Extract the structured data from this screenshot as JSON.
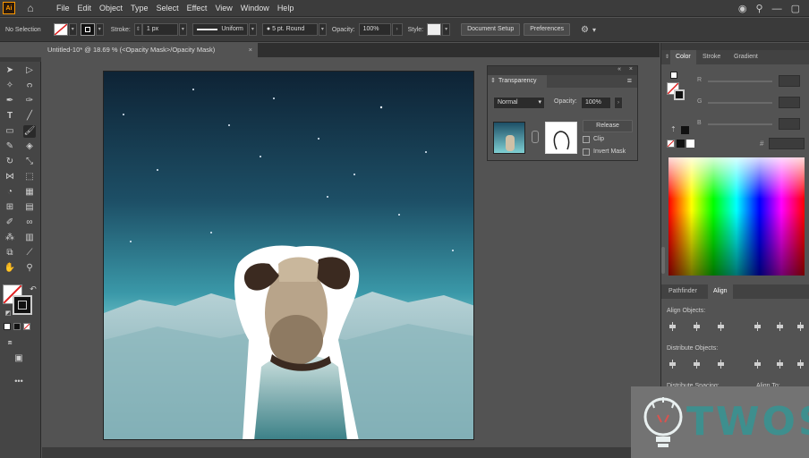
{
  "menubar": {
    "app_icon": "Ai",
    "items": [
      "File",
      "Edit",
      "Object",
      "Type",
      "Select",
      "Effect",
      "View",
      "Window",
      "Help"
    ]
  },
  "controlbar": {
    "selection_label": "No Selection",
    "stroke_label": "Stroke:",
    "stroke_weight": "1 px",
    "profile": "Uniform",
    "brush": "5 pt. Round",
    "opacity_label": "Opacity:",
    "opacity": "100%",
    "style_label": "Style:",
    "document_setup": "Document Setup",
    "preferences": "Preferences"
  },
  "document": {
    "tab_title": "Untitled-10* @ 18.69 % (<Opacity Mask>/Opacity Mask)",
    "close": "×"
  },
  "transparency": {
    "title": "Transparency",
    "blend_mode": "Normal",
    "opacity_label": "Opacity:",
    "opacity": "100%",
    "release": "Release",
    "clip": "Clip",
    "invert_mask": "Invert Mask",
    "collapse": "«",
    "close": "×"
  },
  "dock": {
    "color_tabs": [
      "Color",
      "Stroke",
      "Gradient"
    ],
    "rgb_labels": [
      "R",
      "G",
      "B"
    ],
    "lower_tabs": [
      "Pathfinder",
      "Align"
    ],
    "align_objects": "Align Objects:",
    "distribute_objects": "Distribute Objects:",
    "distribute_spacing": "Distribute Spacing:",
    "align_to": "Align To:"
  },
  "watermark": {
    "text": "TWOS"
  },
  "colors": {
    "accent": "#ff9a00",
    "panel": "#535353",
    "watermark_teal": "#3e8f8e"
  }
}
